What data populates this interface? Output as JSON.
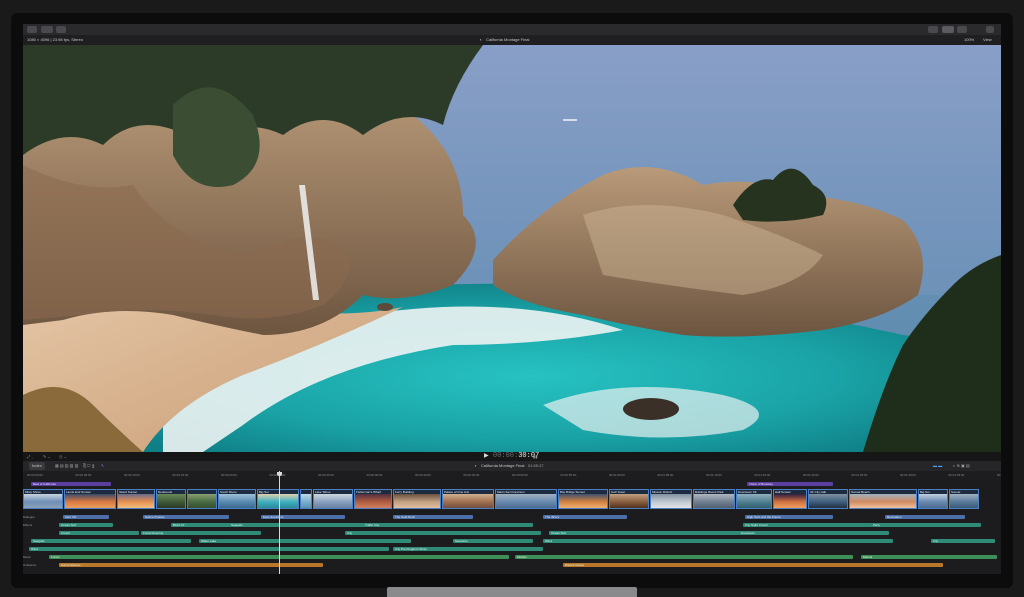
{
  "toolbar": {
    "left_buttons": [
      "import-icon",
      "keyword-icon",
      "background-tasks-icon"
    ],
    "right_buttons": [
      "library-icon",
      "browser-icon",
      "inspector-icon",
      "share-icon"
    ]
  },
  "infobar": {
    "format": "1080 × 4096 | 23.98 fps, Stereo",
    "project_title": "California Montage Final",
    "zoom": "100%",
    "view": "View"
  },
  "viewer": {
    "timecode_dim": "00:00:",
    "timecode": "30:07",
    "play_icon": "play-icon"
  },
  "timeline": {
    "index_label": "Index",
    "project_title": "California Montage Final",
    "duration": "01:55:37",
    "ruler": [
      "00:00:00:00",
      "00:00:05:00",
      "00:00:10:00",
      "00:00:15:00",
      "00:00:20:00",
      "00:00:25:00",
      "00:00:30:00",
      "00:00:35:00",
      "00:00:40:00",
      "00:00:45:00",
      "00:00:50:00",
      "00:00:55:00",
      "00:01:00:00",
      "00:01:05:00",
      "00:01:10:00",
      "00:01:15:00",
      "00:01:20:00",
      "00:01:25:00",
      "00:01:30:00",
      "00:01:35:00",
      "00:01:40:00"
    ],
    "titles": [
      {
        "label": "Best of California"
      },
      {
        "label": "Vision of Berkeley"
      }
    ],
    "video_clips": [
      {
        "label": "Misty Shore"
      },
      {
        "label": "Lands End Sunset"
      },
      {
        "label": "Island Sunset"
      },
      {
        "label": "Redwoods"
      },
      {
        "label": ""
      },
      {
        "label": "South Shore"
      },
      {
        "label": "Big Sur"
      },
      {
        "label": ""
      },
      {
        "label": "Lake Tahoe"
      },
      {
        "label": "Fisherman's Wharf"
      },
      {
        "label": "Ferry Building"
      },
      {
        "label": "Palace of Fine Arts"
      },
      {
        "label": "Marin San Francisco"
      },
      {
        "label": "Bay Bridge Sunset"
      },
      {
        "label": "Golf Tower"
      },
      {
        "label": "Mission District"
      },
      {
        "label": "Buildings Rivers Park"
      },
      {
        "label": "Downtown SF"
      },
      {
        "label": "Half Sunset"
      },
      {
        "label": "SF City Hall"
      },
      {
        "label": "Sunset Beach"
      },
      {
        "label": "Big Sur"
      },
      {
        "label": "Sunset"
      }
    ],
    "lanes": [
      {
        "name": "Dialogue",
        "clips": [
          {
            "label": "Intro VO"
          },
          {
            "label": "Native Prairies"
          },
          {
            "label": "Early Explorers"
          },
          {
            "label": "The Gold Rush"
          },
          {
            "label": "The 49'ers"
          },
          {
            "label": "High Tech and the Future"
          },
          {
            "label": "Recreation"
          }
        ]
      },
      {
        "name": "Effects",
        "clips": [
          {
            "label": "Ocean Surf"
          },
          {
            "label": "Birds FX"
          },
          {
            "label": "Seagulls"
          },
          {
            "label": "Traffic City"
          },
          {
            "label": "City Night Crowd"
          },
          {
            "label": "Party"
          }
        ]
      },
      {
        "name": "",
        "clips": [
          {
            "label": "Crowd"
          },
          {
            "label": "Forest Evening"
          },
          {
            "label": "City"
          },
          {
            "label": "Ocean Surf"
          },
          {
            "label": "Downtown"
          }
        ]
      },
      {
        "name": "",
        "clips": [
          {
            "label": "Seagulls"
          },
          {
            "label": "Water Lake"
          },
          {
            "label": "Wind"
          },
          {
            "label": "City"
          },
          {
            "label": "Seashore"
          }
        ]
      },
      {
        "name": "",
        "clips": [
          {
            "label": "Wind"
          },
          {
            "label": "City Pre Kingdom Show"
          }
        ]
      },
      {
        "name": "Music",
        "clips": [
          {
            "label": "Forest"
          },
          {
            "label": "Modern"
          },
          {
            "label": "Marina"
          }
        ]
      },
      {
        "name": "Ambience",
        "clips": [
          {
            "label": "Surf Ambience"
          },
          {
            "label": "Distant Voices"
          }
        ]
      }
    ]
  },
  "colors": {
    "video": "#4d7fc3",
    "dialogue": "#4d6ea8",
    "effects": "#2f8a78",
    "music": "#3d8f57",
    "ambience": "#b8772a",
    "title": "#7a52c8"
  }
}
